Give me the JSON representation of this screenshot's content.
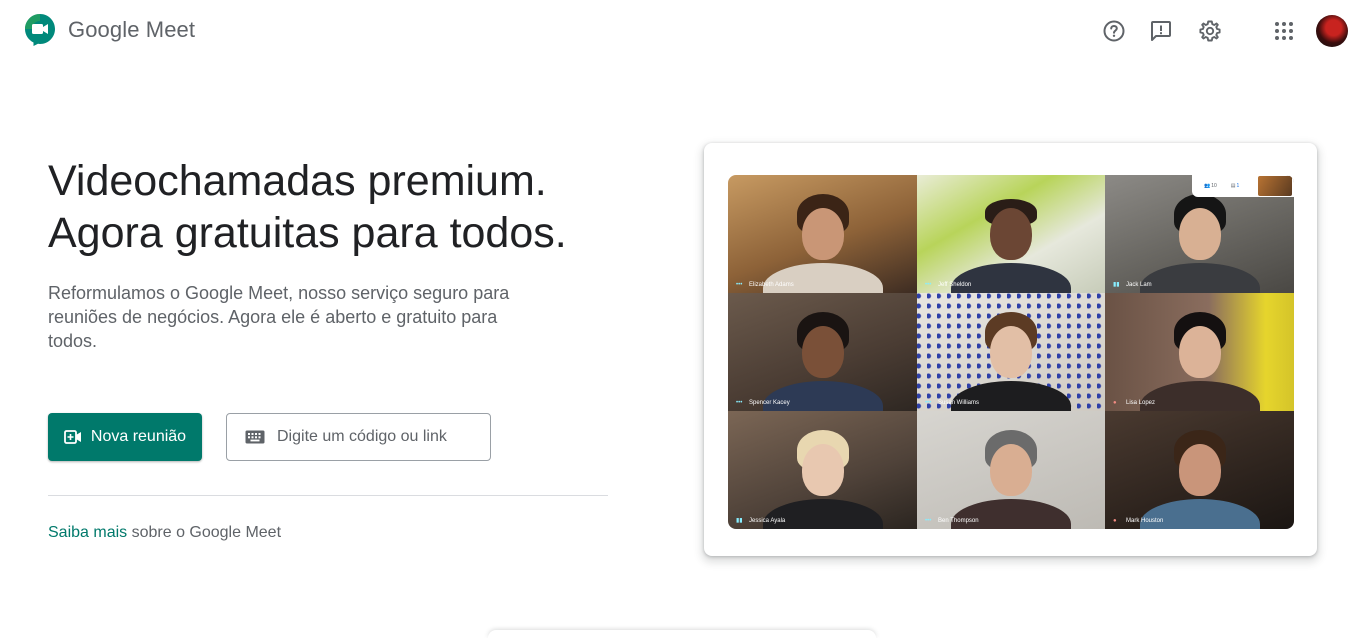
{
  "app": {
    "logo_word1": "Google",
    "logo_word2": "Meet"
  },
  "header": {
    "icons": [
      "help-icon",
      "feedback-icon",
      "settings-icon",
      "apps-icon"
    ],
    "colors": {
      "accent": "#00796b",
      "icon": "#5f6368"
    }
  },
  "hero": {
    "headline_line1": "Videochamadas premium.",
    "headline_line2": "Agora gratuitas para todos.",
    "subtitle": "Reformulamos o Google Meet, nosso serviço seguro para reuniões de negócios. Agora ele é aberto e gratuito para todos.",
    "new_meeting_label": "Nova reunião",
    "code_placeholder": "Digite um código ou link",
    "learn_link": "Saiba mais",
    "learn_suffix": " sobre o Google Meet"
  },
  "illustration": {
    "participants": [
      {
        "name": "Elizabeth Adams"
      },
      {
        "name": "Jeff Sheldon"
      },
      {
        "name": "Jack Lam"
      },
      {
        "name": "Spencer Kacey"
      },
      {
        "name": "Susan Williams"
      },
      {
        "name": "Lisa Lopez"
      },
      {
        "name": "Jessica Ayala"
      },
      {
        "name": "Ben Thompson"
      },
      {
        "name": "Mark Houston"
      }
    ],
    "mini_bar": {
      "people_count": "10",
      "chat_count": "1"
    }
  }
}
